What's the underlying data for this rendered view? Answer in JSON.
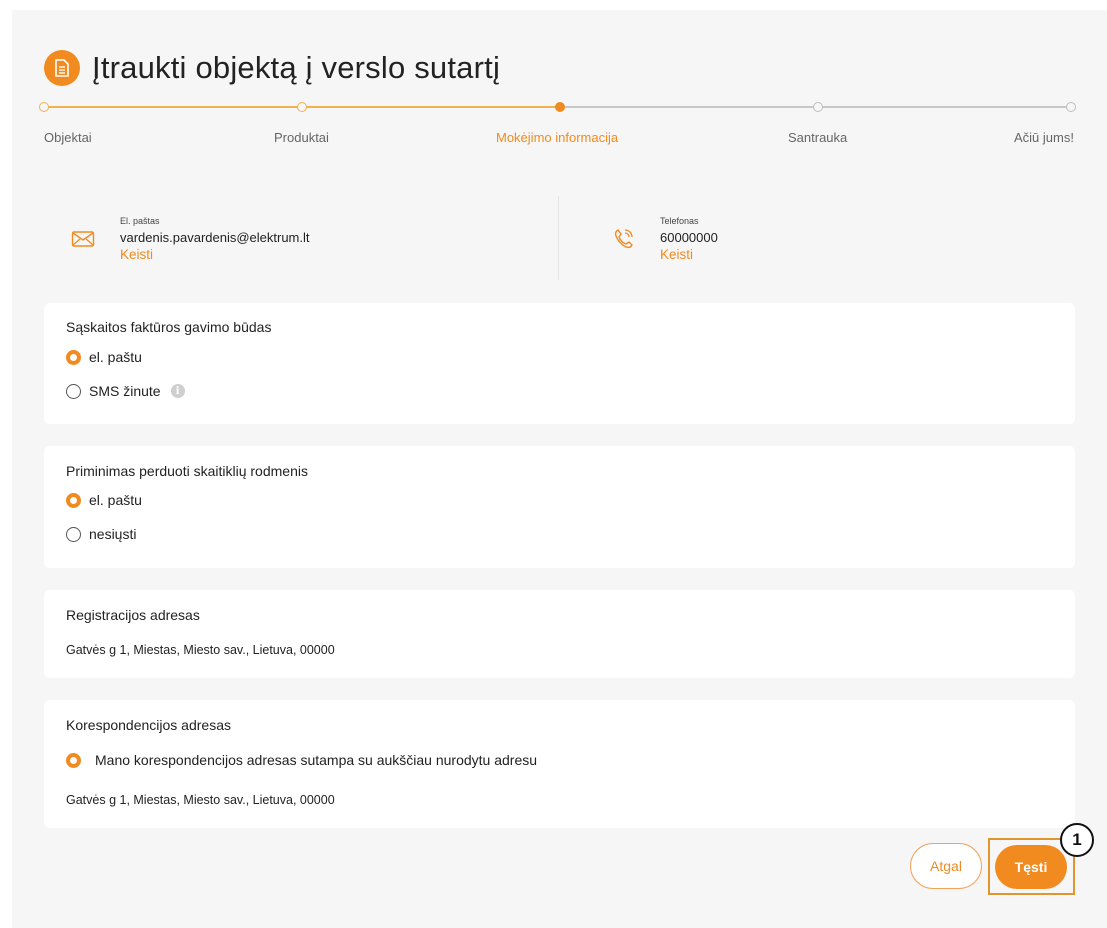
{
  "page": {
    "title": "Įtraukti objektą į verslo sutartį"
  },
  "steps": [
    {
      "label": "Objektai",
      "state": "done"
    },
    {
      "label": "Produktai",
      "state": "done"
    },
    {
      "label": "Mokėjimo informacija",
      "state": "active"
    },
    {
      "label": "Santrauka",
      "state": "pending"
    },
    {
      "label": "Ačiū jums!",
      "state": "pending"
    }
  ],
  "contact": {
    "email_caption": "El. paštas",
    "email_value": "vardenis.pavardenis@elektrum.lt",
    "email_change": "Keisti",
    "phone_caption": "Telefonas",
    "phone_value": "60000000",
    "phone_change": "Keisti"
  },
  "invoice": {
    "title": "Sąskaitos faktūros gavimo būdas",
    "options": [
      {
        "label": "el. paštu",
        "selected": true
      },
      {
        "label": "SMS žinute",
        "selected": false
      }
    ],
    "info_glyph": "i"
  },
  "reminder": {
    "title": "Priminimas perduoti skaitiklių rodmenis",
    "options": [
      {
        "label": "el. paštu",
        "selected": true
      },
      {
        "label": "nesiųsti",
        "selected": false
      }
    ]
  },
  "registration": {
    "title": "Registracijos adresas",
    "address": "Gatvės g 1, Miestas, Miesto sav., Lietuva, 00000"
  },
  "correspondence": {
    "title": "Korespondencijos adresas",
    "option": {
      "label": "Mano korespondencijos adresas sutampa su aukščiau nurodytu adresu",
      "selected": true
    },
    "address": "Gatvės g 1, Miestas, Miesto sav., Lietuva, 00000"
  },
  "actions": {
    "back_label": "Atgal",
    "next_label": "Tęsti",
    "callout_number": "1"
  },
  "colors": {
    "accent": "#f18a1f",
    "background": "#f6f6f6",
    "card": "#ffffff"
  },
  "icons": {
    "title": "document-icon",
    "email": "envelope-icon",
    "phone": "phone-icon",
    "info": "info-icon"
  }
}
